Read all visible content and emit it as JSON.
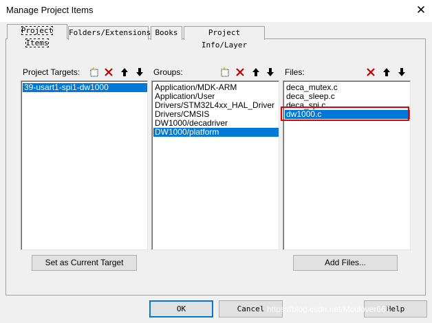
{
  "window": {
    "title": "Manage Project Items"
  },
  "tabs": [
    {
      "label": "Project Items"
    },
    {
      "label": "Folders/Extensions"
    },
    {
      "label": "Books"
    },
    {
      "label": "Project Info/Layer"
    }
  ],
  "targets": {
    "header": "Project Targets:",
    "items": [
      "39-usart1-spi1-dw1000"
    ],
    "selected_index": 0
  },
  "groups": {
    "header": "Groups:",
    "items": [
      "Application/MDK-ARM",
      "Application/User",
      "Drivers/STM32L4xx_HAL_Driver",
      "Drivers/CMSIS",
      "DW1000/decadriver",
      "DW1000/platform"
    ],
    "selected_index": 5
  },
  "files": {
    "header": "Files:",
    "items": [
      "deca_mutex.c",
      "deca_sleep.c",
      "deca_spi.c",
      "dw1000.c"
    ],
    "selected_index": 3
  },
  "buttons": {
    "set_current": "Set as Current Target",
    "add_files": "Add Files...",
    "ok": "OK",
    "cancel": "Cancel",
    "help": "Help"
  },
  "watermark": "https://blog.csdn.net/Mculover666",
  "icons": {
    "new": "new-item-icon",
    "delete": "delete-icon",
    "up": "move-up-icon",
    "down": "move-down-icon"
  },
  "colors": {
    "selection": "#0078d7",
    "highlight_box": "#e00000",
    "delete_red": "#c00000"
  }
}
